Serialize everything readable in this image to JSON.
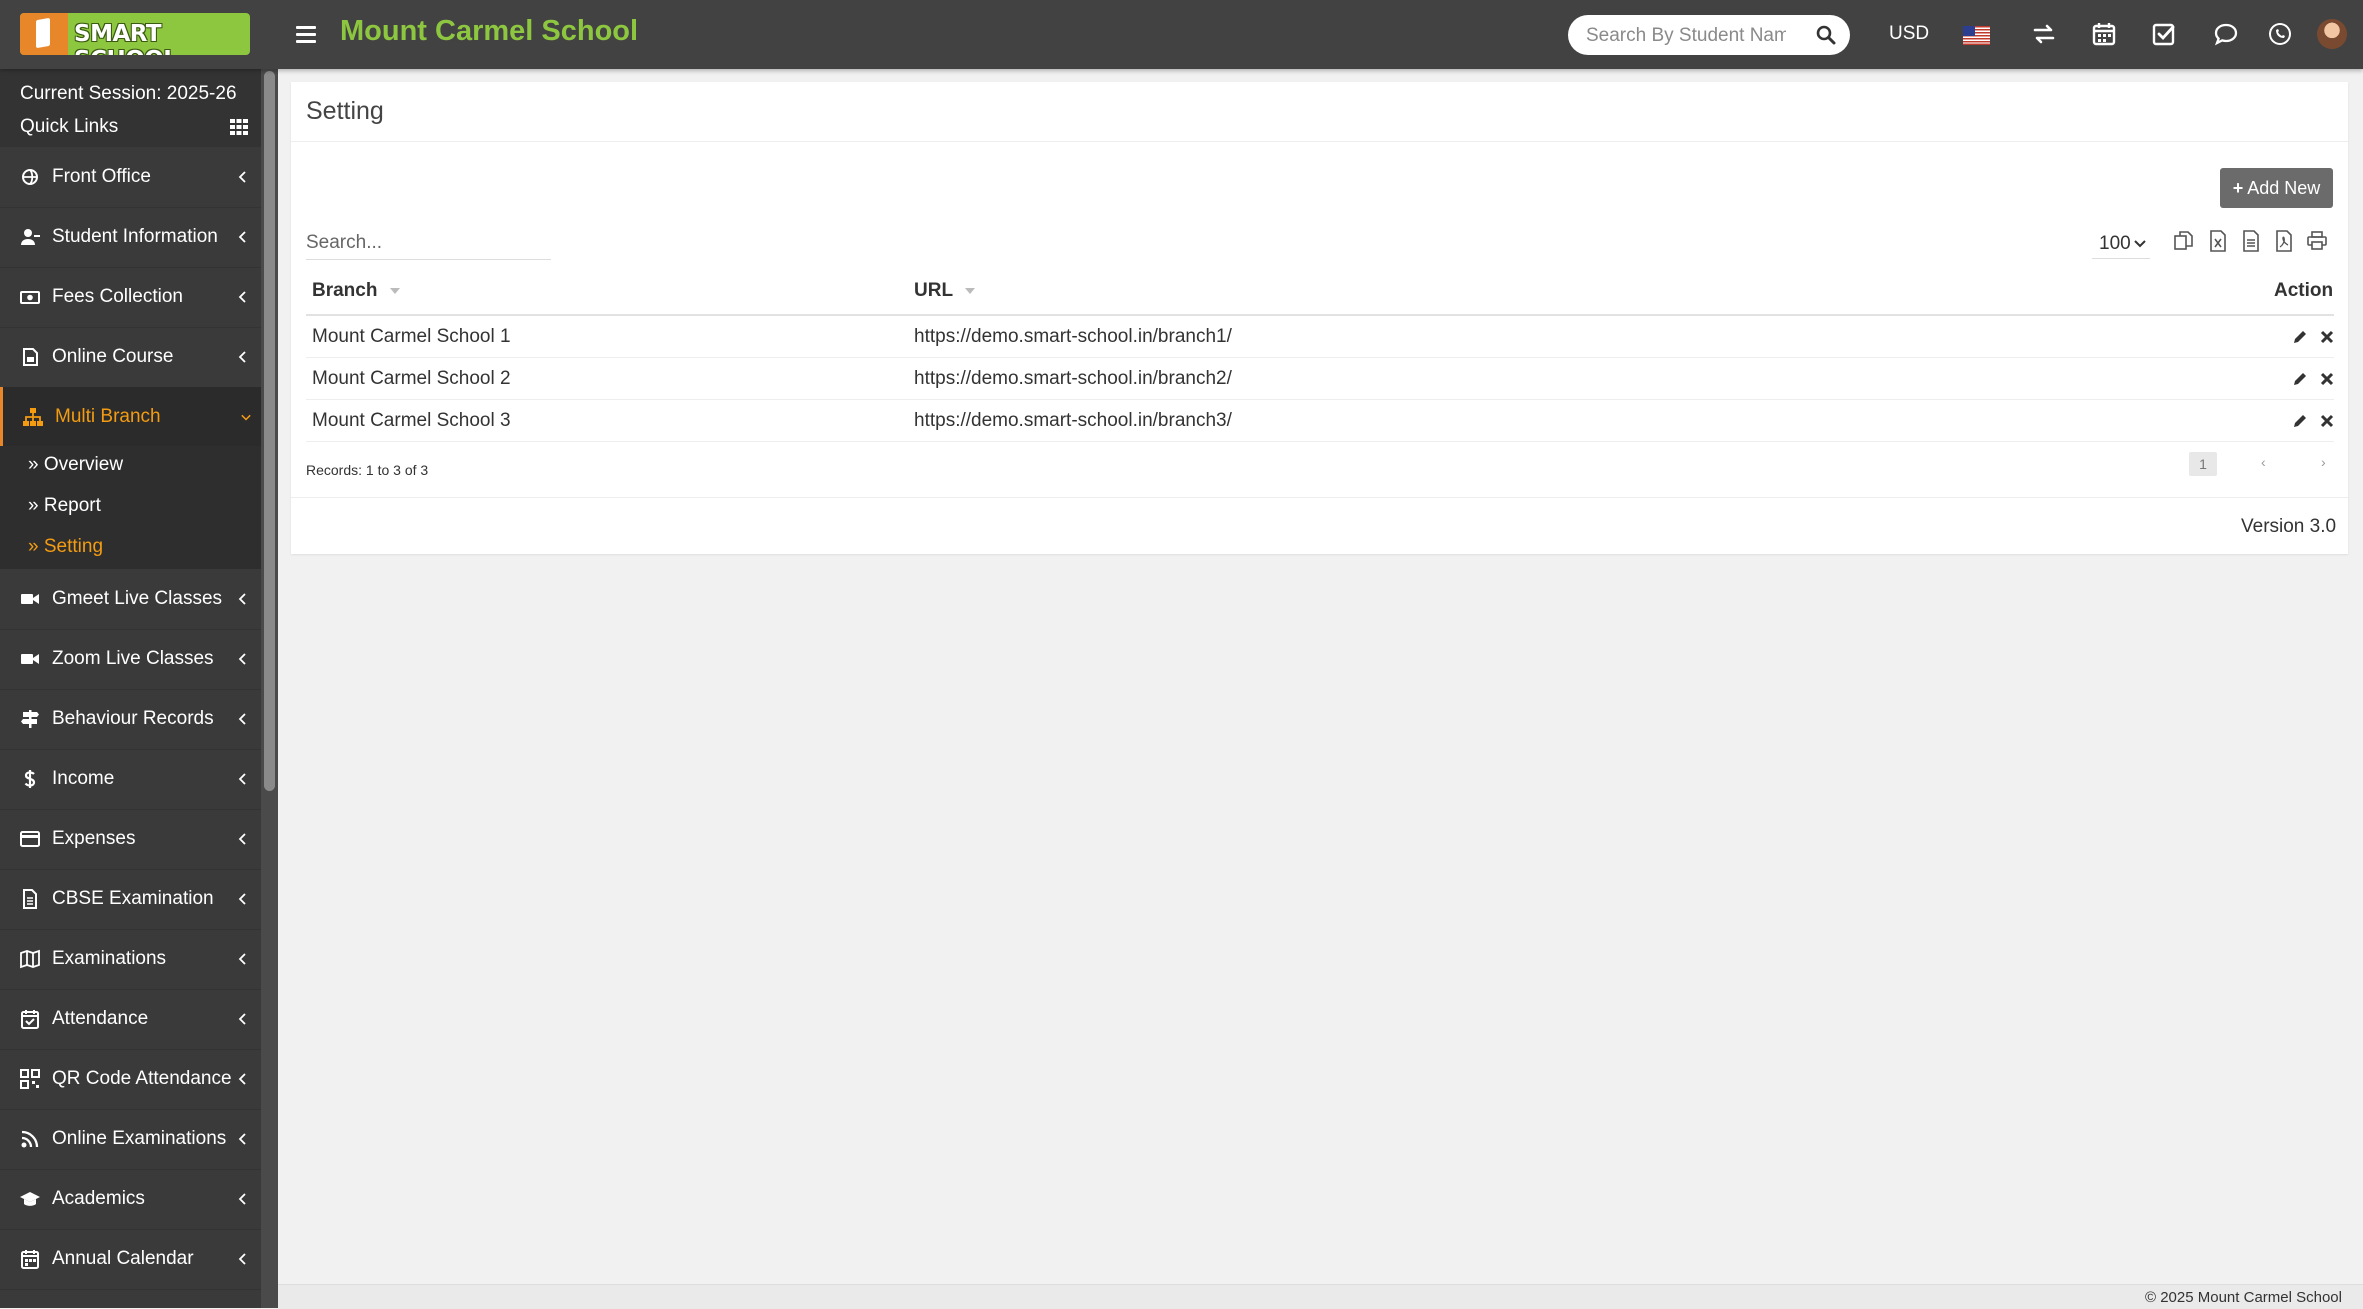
{
  "header": {
    "logo_text": "SMART SCHOOL",
    "school_name": "Mount Carmel School",
    "search_placeholder": "Search By Student Name",
    "currency": "USD",
    "icons": [
      "us-flag-icon",
      "exchange-icon",
      "calendar-icon",
      "task-check-icon",
      "chat-icon",
      "whatsapp-icon",
      "user-avatar"
    ]
  },
  "sidebar": {
    "session": "Current Session: 2025-26",
    "quick_links": "Quick Links",
    "items": [
      {
        "label": "Front Office",
        "icon": "front-office-icon"
      },
      {
        "label": "Student Information",
        "icon": "student-icon"
      },
      {
        "label": "Fees Collection",
        "icon": "money-icon"
      },
      {
        "label": "Online Course",
        "icon": "course-icon"
      },
      {
        "label": "Multi Branch",
        "icon": "sitemap-icon",
        "active": true
      },
      {
        "label": "Gmeet Live Classes",
        "icon": "video-icon"
      },
      {
        "label": "Zoom Live Classes",
        "icon": "video-icon"
      },
      {
        "label": "Behaviour Records",
        "icon": "signpost-icon"
      },
      {
        "label": "Income",
        "icon": "dollar-icon"
      },
      {
        "label": "Expenses",
        "icon": "credit-card-icon"
      },
      {
        "label": "CBSE Examination",
        "icon": "document-icon"
      },
      {
        "label": "Examinations",
        "icon": "map-icon"
      },
      {
        "label": "Attendance",
        "icon": "calendar-check-icon"
      },
      {
        "label": "QR Code Attendance",
        "icon": "qrcode-icon"
      },
      {
        "label": "Online Examinations",
        "icon": "rss-icon"
      },
      {
        "label": "Academics",
        "icon": "graduation-cap-icon"
      },
      {
        "label": "Annual Calendar",
        "icon": "calendar-icon"
      }
    ],
    "submenu": [
      {
        "label": "Overview"
      },
      {
        "label": "Report"
      },
      {
        "label": "Setting",
        "active": true
      }
    ]
  },
  "main": {
    "title": "Setting",
    "add_button": "Add New",
    "search_placeholder": "Search...",
    "page_size": "100",
    "export_icons": [
      "copy-icon",
      "excel-icon",
      "csv-icon",
      "pdf-icon",
      "print-icon"
    ],
    "columns": [
      "Branch",
      "URL",
      "Action"
    ],
    "rows": [
      {
        "branch": "Mount Carmel School 1",
        "url": "https://demo.smart-school.in/branch1/"
      },
      {
        "branch": "Mount Carmel School 2",
        "url": "https://demo.smart-school.in/branch2/"
      },
      {
        "branch": "Mount Carmel School 3",
        "url": "https://demo.smart-school.in/branch3/"
      }
    ],
    "records_info": "Records: 1 to 3 of 3",
    "pagination": {
      "prev": "‹",
      "current": "1",
      "next": "›"
    },
    "version": "Version 3.0"
  },
  "footer": {
    "copyright": "© 2025 Mount Carmel School"
  },
  "colors": {
    "topbar": "#424242",
    "brand_green": "#8dc63f",
    "accent_orange": "#f39c12",
    "sidebar": "#3a3a3a"
  }
}
